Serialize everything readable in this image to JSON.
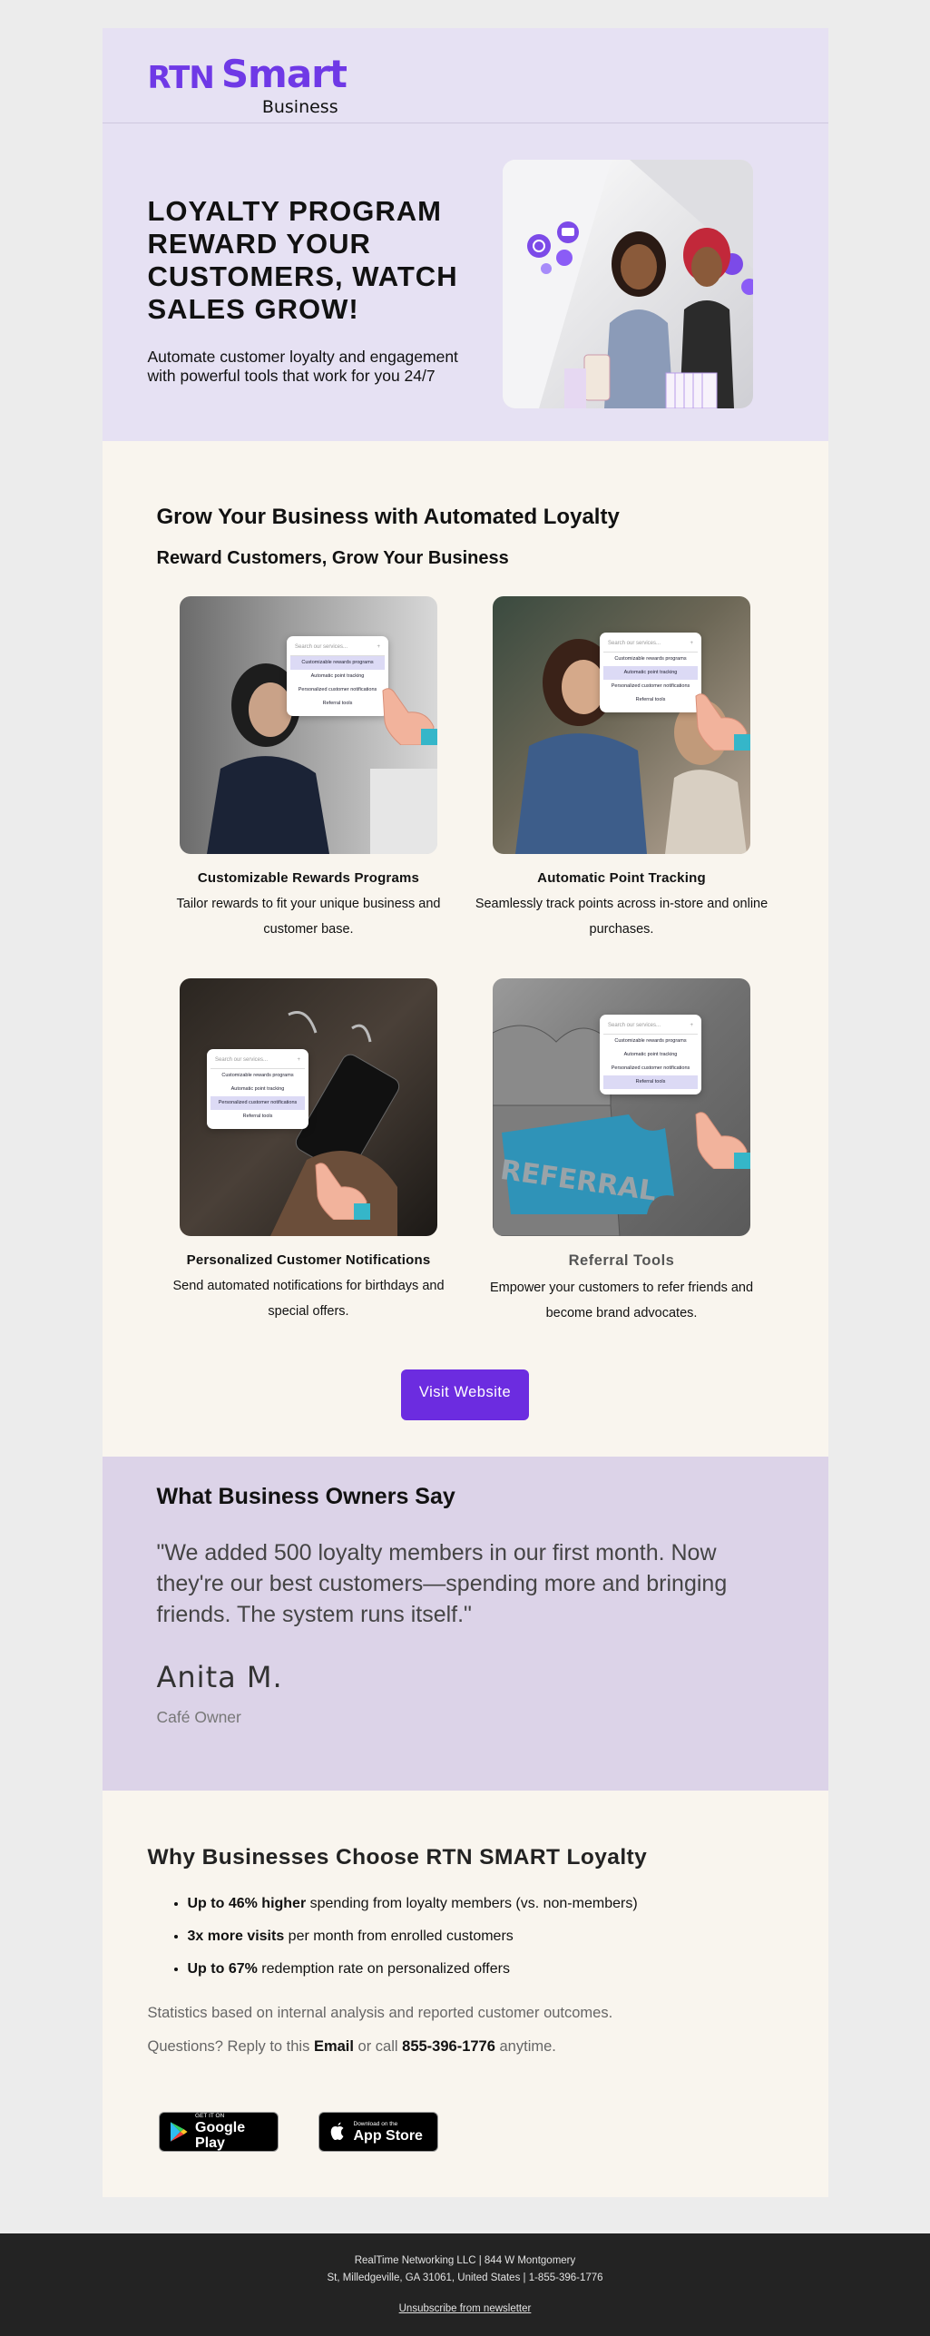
{
  "brand": {
    "logo_main": "RTN",
    "logo_smart": "Smart",
    "logo_sub": "Business",
    "accent": "#6c2ce0",
    "header_bg": "#e6e1f3"
  },
  "hero": {
    "title": "LOYALTY PROGRAM REWARD YOUR CUSTOMERS, WATCH SALES GROW!",
    "subtitle": "Automate customer loyalty and engagement with powerful tools that work for you 24/7"
  },
  "features": {
    "heading": "Grow Your Business with Automated Loyalty",
    "subheading": "Reward Customers, Grow Your Business",
    "mock": {
      "search_placeholder": "Search our services...",
      "plus": "+",
      "items": [
        "Customizable rewards programs",
        "Automatic point tracking",
        "Personalized customer notifications",
        "Referral tools"
      ]
    },
    "cards": [
      {
        "title": "Customizable Rewards Programs",
        "desc": "Tailor rewards to fit your unique business and customer base."
      },
      {
        "title": "Automatic Point Tracking",
        "desc": "Seamlessly track points across in-store and online purchases."
      },
      {
        "title": "Personalized Customer Notifications",
        "desc": "Send automated notifications for birthdays and special offers."
      },
      {
        "title": "Referral Tools",
        "desc": "Empower your customers to refer friends and become brand advocates.",
        "image_word": "REFERRAL"
      }
    ],
    "button": "Visit Website"
  },
  "testimonial": {
    "heading": "What Business Owners Say",
    "quote": "\"We added 500 loyalty members in our first month. Now they're our best customers—spending more and bringing friends. The system runs itself.\"",
    "name": "Anita M.",
    "role": "Café Owner"
  },
  "why": {
    "heading": "Why Businesses Choose RTN SMART Loyalty",
    "bullets": [
      {
        "bold": "Up to 46% higher",
        "rest": " spending from loyalty members (vs. non-members)"
      },
      {
        "bold": "3x more visits",
        "rest": " per month from enrolled customers"
      },
      {
        "bold": "Up to 67%",
        "rest": " redemption rate on personalized offers"
      }
    ],
    "note": "Statistics based on internal analysis and reported customer outcomes.",
    "contact_pre": "Questions? Reply to this ",
    "contact_email": "Email",
    "contact_mid": " or call ",
    "contact_phone": "855-396-1776",
    "contact_post": " anytime.",
    "google_small": "GET IT ON",
    "google_big": "Google Play",
    "apple_small": "Download on the",
    "apple_big": "App Store"
  },
  "footer": {
    "line1": "RealTime Networking LLC | 844 W Montgomery",
    "line2": "St, Milledgeville, GA 31061, United States | 1-855-396-1776",
    "unsubscribe": "Unsubscribe from newsletter"
  }
}
